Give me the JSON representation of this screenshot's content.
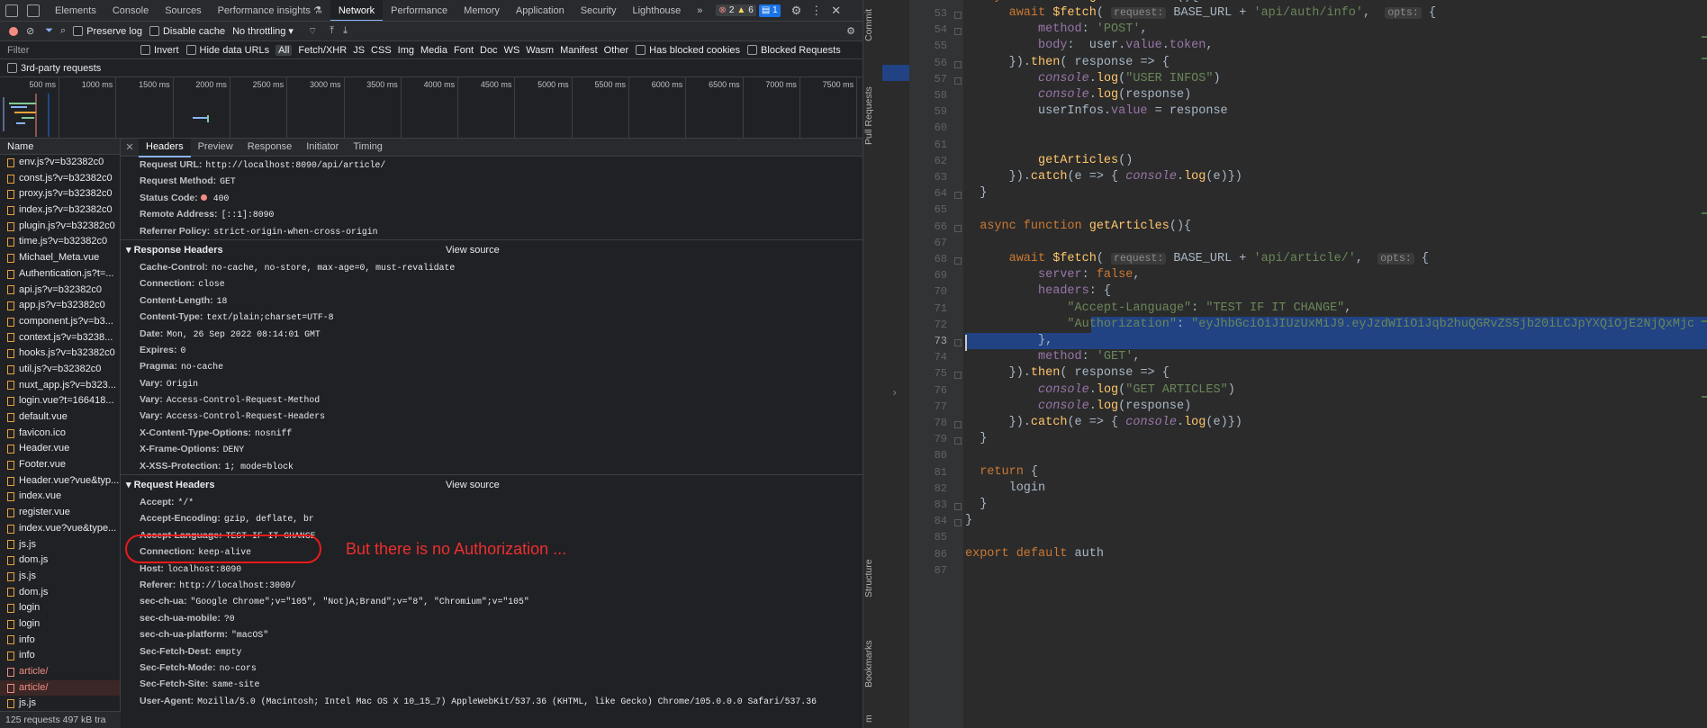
{
  "devtools": {
    "tabs": [
      "Elements",
      "Console",
      "Sources",
      "Performance insights ⚗",
      "Network",
      "Performance",
      "Memory",
      "Application",
      "Security",
      "Lighthouse"
    ],
    "active_tab": "Network",
    "more": "»",
    "badges": {
      "errors": "2",
      "warnings": "6",
      "messages": "1"
    },
    "toolbar": {
      "preserve_log": "Preserve log",
      "disable_cache": "Disable cache",
      "throttle": "No throttling"
    },
    "filter": {
      "placeholder": "Filter",
      "invert": "Invert",
      "hide_data_urls": "Hide data URLs",
      "types": [
        "All",
        "Fetch/XHR",
        "JS",
        "CSS",
        "Img",
        "Media",
        "Font",
        "Doc",
        "WS",
        "Wasm",
        "Manifest",
        "Other"
      ],
      "has_blocked": "Has blocked cookies",
      "blocked_requests": "Blocked Requests",
      "third_party": "3rd-party requests"
    },
    "timeline_ticks": [
      "500 ms",
      "1000 ms",
      "1500 ms",
      "2000 ms",
      "2500 ms",
      "3000 ms",
      "3500 ms",
      "4000 ms",
      "4500 ms",
      "5000 ms",
      "5500 ms",
      "6000 ms",
      "6500 ms",
      "7000 ms",
      "7500 ms"
    ],
    "name_header": "Name",
    "requests": [
      {
        "name": "env.js?v=b32382c0",
        "err": false
      },
      {
        "name": "const.js?v=b32382c0",
        "err": false
      },
      {
        "name": "proxy.js?v=b32382c0",
        "err": false
      },
      {
        "name": "index.js?v=b32382c0",
        "err": false
      },
      {
        "name": "plugin.js?v=b32382c0",
        "err": false
      },
      {
        "name": "time.js?v=b32382c0",
        "err": false
      },
      {
        "name": "Michael_Meta.vue",
        "err": false
      },
      {
        "name": "Authentication.js?t=...",
        "err": false
      },
      {
        "name": "api.js?v=b32382c0",
        "err": false
      },
      {
        "name": "app.js?v=b32382c0",
        "err": false
      },
      {
        "name": "component.js?v=b3...",
        "err": false
      },
      {
        "name": "context.js?v=b3238...",
        "err": false
      },
      {
        "name": "hooks.js?v=b32382c0",
        "err": false
      },
      {
        "name": "util.js?v=b32382c0",
        "err": false
      },
      {
        "name": "nuxt_app.js?v=b323...",
        "err": false
      },
      {
        "name": "login.vue?t=166418...",
        "err": false
      },
      {
        "name": "default.vue",
        "err": false
      },
      {
        "name": "favicon.ico",
        "err": false
      },
      {
        "name": "Header.vue",
        "err": false
      },
      {
        "name": "Footer.vue",
        "err": false
      },
      {
        "name": "Header.vue?vue&typ...",
        "err": false
      },
      {
        "name": "index.vue",
        "err": false
      },
      {
        "name": "register.vue",
        "err": false
      },
      {
        "name": "index.vue?vue&type...",
        "err": false
      },
      {
        "name": "js.js",
        "err": false
      },
      {
        "name": "dom.js",
        "err": false
      },
      {
        "name": "js.js",
        "err": false
      },
      {
        "name": "dom.js",
        "err": false
      },
      {
        "name": "login",
        "err": false
      },
      {
        "name": "login",
        "err": false
      },
      {
        "name": "info",
        "err": false
      },
      {
        "name": "info",
        "err": false
      },
      {
        "name": "article/",
        "err": true
      },
      {
        "name": "article/",
        "err": true
      },
      {
        "name": "js.js",
        "err": false
      }
    ],
    "footer": "125 requests   497 kB tra",
    "detail_tabs": [
      "Headers",
      "Preview",
      "Response",
      "Initiator",
      "Timing"
    ],
    "general": [
      {
        "k": "Request URL:",
        "v": "http://localhost:8090/api/article/"
      },
      {
        "k": "Request Method:",
        "v": "GET"
      },
      {
        "k": "Status Code:",
        "v": "400"
      },
      {
        "k": "Remote Address:",
        "v": "[::1]:8090"
      },
      {
        "k": "Referrer Policy:",
        "v": "strict-origin-when-cross-origin"
      }
    ],
    "response_headers_title": "Response Headers",
    "view_source": "View source",
    "response_headers": [
      {
        "k": "Cache-Control:",
        "v": "no-cache, no-store, max-age=0, must-revalidate"
      },
      {
        "k": "Connection:",
        "v": "close"
      },
      {
        "k": "Content-Length:",
        "v": "18"
      },
      {
        "k": "Content-Type:",
        "v": "text/plain;charset=UTF-8"
      },
      {
        "k": "Date:",
        "v": "Mon, 26 Sep 2022 08:14:01 GMT"
      },
      {
        "k": "Expires:",
        "v": "0"
      },
      {
        "k": "Pragma:",
        "v": "no-cache"
      },
      {
        "k": "Vary:",
        "v": "Origin"
      },
      {
        "k": "Vary:",
        "v": "Access-Control-Request-Method"
      },
      {
        "k": "Vary:",
        "v": "Access-Control-Request-Headers"
      },
      {
        "k": "X-Content-Type-Options:",
        "v": "nosniff"
      },
      {
        "k": "X-Frame-Options:",
        "v": "DENY"
      },
      {
        "k": "X-XSS-Protection:",
        "v": "1; mode=block"
      }
    ],
    "request_headers_title": "Request Headers",
    "request_headers": [
      {
        "k": "Accept:",
        "v": "*/*"
      },
      {
        "k": "Accept-Encoding:",
        "v": "gzip, deflate, br"
      },
      {
        "k": "Accept-Language:",
        "v": "TEST IF IT CHANGE"
      },
      {
        "k": "Connection:",
        "v": "keep-alive"
      },
      {
        "k": "Host:",
        "v": "localhost:8090"
      },
      {
        "k": "Referer:",
        "v": "http://localhost:3000/"
      },
      {
        "k": "sec-ch-ua:",
        "v": "\"Google Chrome\";v=\"105\", \"Not)A;Brand\";v=\"8\", \"Chromium\";v=\"105\""
      },
      {
        "k": "sec-ch-ua-mobile:",
        "v": "?0"
      },
      {
        "k": "sec-ch-ua-platform:",
        "v": "\"macOS\""
      },
      {
        "k": "Sec-Fetch-Dest:",
        "v": "empty"
      },
      {
        "k": "Sec-Fetch-Mode:",
        "v": "no-cors"
      },
      {
        "k": "Sec-Fetch-Site:",
        "v": "same-site"
      },
      {
        "k": "User-Agent:",
        "v": "Mozilla/5.0 (Macintosh; Intel Mac OS X 10_15_7) AppleWebKit/537.36 (KHTML, like Gecko) Chrome/105.0.0.0 Safari/537.36"
      }
    ],
    "annotation": "But there is no Authorization ..."
  },
  "ide": {
    "side_labels": [
      "Commit",
      "Pull Requests",
      "Structure",
      "Bookmarks",
      "m"
    ],
    "line_numbers": [
      "53",
      "54",
      "55",
      "56",
      "57",
      "58",
      "59",
      "60",
      "61",
      "62",
      "63",
      "64",
      "65",
      "66",
      "67",
      "68",
      "69",
      "70",
      "71",
      "72",
      "73",
      "74",
      "75",
      "76",
      "77",
      "78",
      "79",
      "80",
      "81",
      "82",
      "83",
      "84",
      "85",
      "86",
      "87"
    ],
    "current_line": "73"
  }
}
